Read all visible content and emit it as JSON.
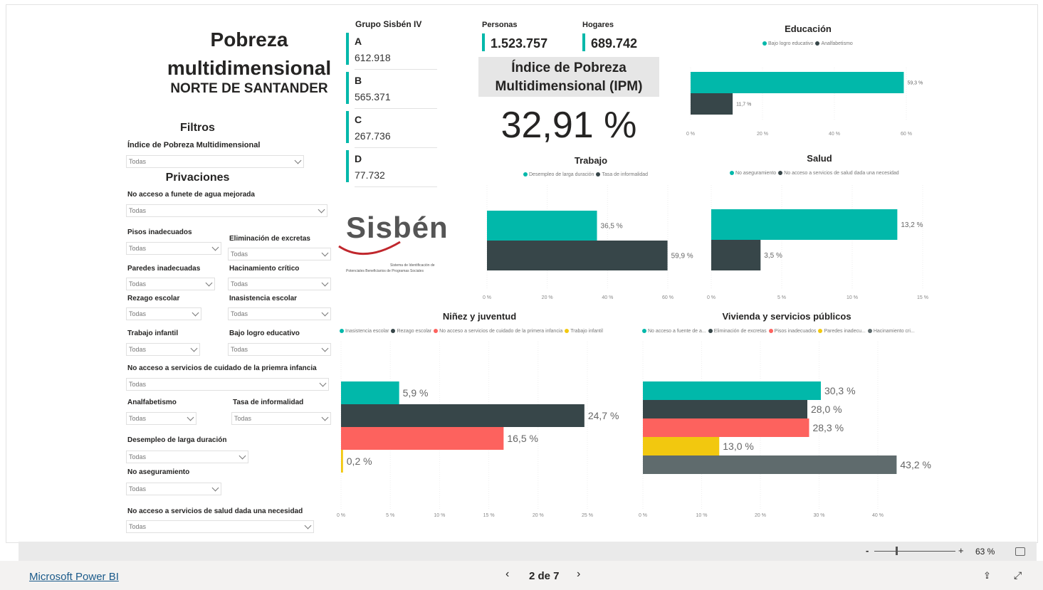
{
  "header": {
    "title": "Pobreza multidimensional",
    "region": "NORTE DE SANTANDER"
  },
  "filters": {
    "heading": "Filtros",
    "ipm_label": "Índice de Pobreza Multidimensional",
    "privaciones_heading": "Privaciones",
    "default_value": "Todas",
    "items": [
      {
        "label": "No acceso a funete de agua mejorada",
        "value": "Todas"
      },
      {
        "label": "Pisos inadecuados",
        "value": "Todas"
      },
      {
        "label": "Eliminación de excretas",
        "value": "Todas"
      },
      {
        "label": "Paredes inadecuadas",
        "value": "Todas"
      },
      {
        "label": "Hacinamiento crítico",
        "value": "Todas"
      },
      {
        "label": "Rezago escolar",
        "value": "Todas"
      },
      {
        "label": "Inasistencia escolar",
        "value": "Todas"
      },
      {
        "label": "Trabajo infantil",
        "value": "Todas"
      },
      {
        "label": "Bajo logro educativo",
        "value": "Todas"
      },
      {
        "label": "No acceso a servicios de cuidado de la priemra infancia",
        "value": "Todas"
      },
      {
        "label": "Analfabetismo",
        "value": "Todas"
      },
      {
        "label": "Tasa de informalidad",
        "value": "Todas"
      },
      {
        "label": "Desempleo de larga duración",
        "value": "Todas"
      },
      {
        "label": "No aseguramiento",
        "value": "Todas"
      },
      {
        "label": "No acceso a servicios de salud dada una necesidad",
        "value": "Todas"
      }
    ]
  },
  "sisben": {
    "title": "Grupo Sisbén IV",
    "groups": [
      {
        "letter": "A",
        "value": "612.918"
      },
      {
        "letter": "B",
        "value": "565.371"
      },
      {
        "letter": "C",
        "value": "267.736"
      },
      {
        "letter": "D",
        "value": "77.732"
      }
    ],
    "logo_text": "Sisbén",
    "logo_sub1": "Sistema de Identificación de",
    "logo_sub2": "Potenciales Beneficiarios de Programas Sociales"
  },
  "kpis": {
    "personas_label": "Personas",
    "personas_value": "1.523.757",
    "hogares_label": "Hogares",
    "hogares_value": "689.742",
    "ipm_title": "Índice de Pobreza Multidimensional (IPM)",
    "ipm_value": "32,91 %"
  },
  "colors": {
    "teal": "#01b8aa",
    "dark": "#374649",
    "red": "#fd625e",
    "yellow": "#f2c80f",
    "gray": "#5f6b6d"
  },
  "chart_data": [
    {
      "id": "educacion",
      "type": "bar",
      "title": "Educación",
      "series_names": [
        "Bajo logro educativo",
        "Analfabetismo"
      ],
      "values": [
        59.3,
        11.7
      ],
      "labels": [
        "59,3 %",
        "11,7 %"
      ],
      "colors": [
        "#01b8aa",
        "#374649"
      ],
      "xlim": [
        0,
        60
      ],
      "ticks": [
        "0 %",
        "20 %",
        "40 %",
        "60 %"
      ]
    },
    {
      "id": "trabajo",
      "type": "bar",
      "title": "Trabajo",
      "series_names": [
        "Desempleo de larga duración",
        "Tasa de informalidad"
      ],
      "values": [
        36.5,
        59.9
      ],
      "labels": [
        "36,5 %",
        "59,9 %"
      ],
      "colors": [
        "#01b8aa",
        "#374649"
      ],
      "xlim": [
        0,
        60
      ],
      "ticks": [
        "0 %",
        "20 %",
        "40 %",
        "60 %"
      ]
    },
    {
      "id": "salud",
      "type": "bar",
      "title": "Salud",
      "series_names": [
        "No aseguramiento",
        "No acceso a servicios de salud dada una necesidad"
      ],
      "values": [
        13.2,
        3.5
      ],
      "labels": [
        "13,2 %",
        "3,5 %"
      ],
      "colors": [
        "#01b8aa",
        "#374649"
      ],
      "xlim": [
        0,
        15
      ],
      "ticks": [
        "0 %",
        "5 %",
        "10 %",
        "15 %"
      ]
    },
    {
      "id": "ninez",
      "type": "bar",
      "title": "Niñez y juventud",
      "series_names": [
        "Inasistencia escolar",
        "Rezago escolar",
        "No acceso a servicios de cuidado de la primera infancia",
        "Trabajo infantil"
      ],
      "values": [
        5.9,
        24.7,
        16.5,
        0.2
      ],
      "labels": [
        "5,9 %",
        "24,7 %",
        "16,5 %",
        "0,2 %"
      ],
      "colors": [
        "#01b8aa",
        "#374649",
        "#fd625e",
        "#f2c80f"
      ],
      "xlim": [
        0,
        25
      ],
      "ticks": [
        "0 %",
        "5 %",
        "10 %",
        "15 %",
        "20 %",
        "25 %"
      ]
    },
    {
      "id": "vivienda",
      "type": "bar",
      "title": "Vivienda y servicios públicos",
      "series_names": [
        "No acceso a fuente de a...",
        "Eliminación de excretas",
        "Pisos inadecuados",
        "Paredes inadecu...",
        "Hacinamiento cri..."
      ],
      "values": [
        30.3,
        28.0,
        28.3,
        13.0,
        43.2
      ],
      "labels": [
        "30,3 %",
        "28,0 %",
        "28,3 %",
        "13,0 %",
        "43,2 %"
      ],
      "colors": [
        "#01b8aa",
        "#374649",
        "#fd625e",
        "#f2c80f",
        "#5f6b6d"
      ],
      "xlim": [
        0,
        40
      ],
      "ticks": [
        "0 %",
        "10 %",
        "20 %",
        "30 %",
        "40 %"
      ]
    }
  ],
  "footer": {
    "brand_link": "Microsoft Power BI",
    "page_indicator": "2 de 7",
    "zoom_level": "63 %"
  }
}
